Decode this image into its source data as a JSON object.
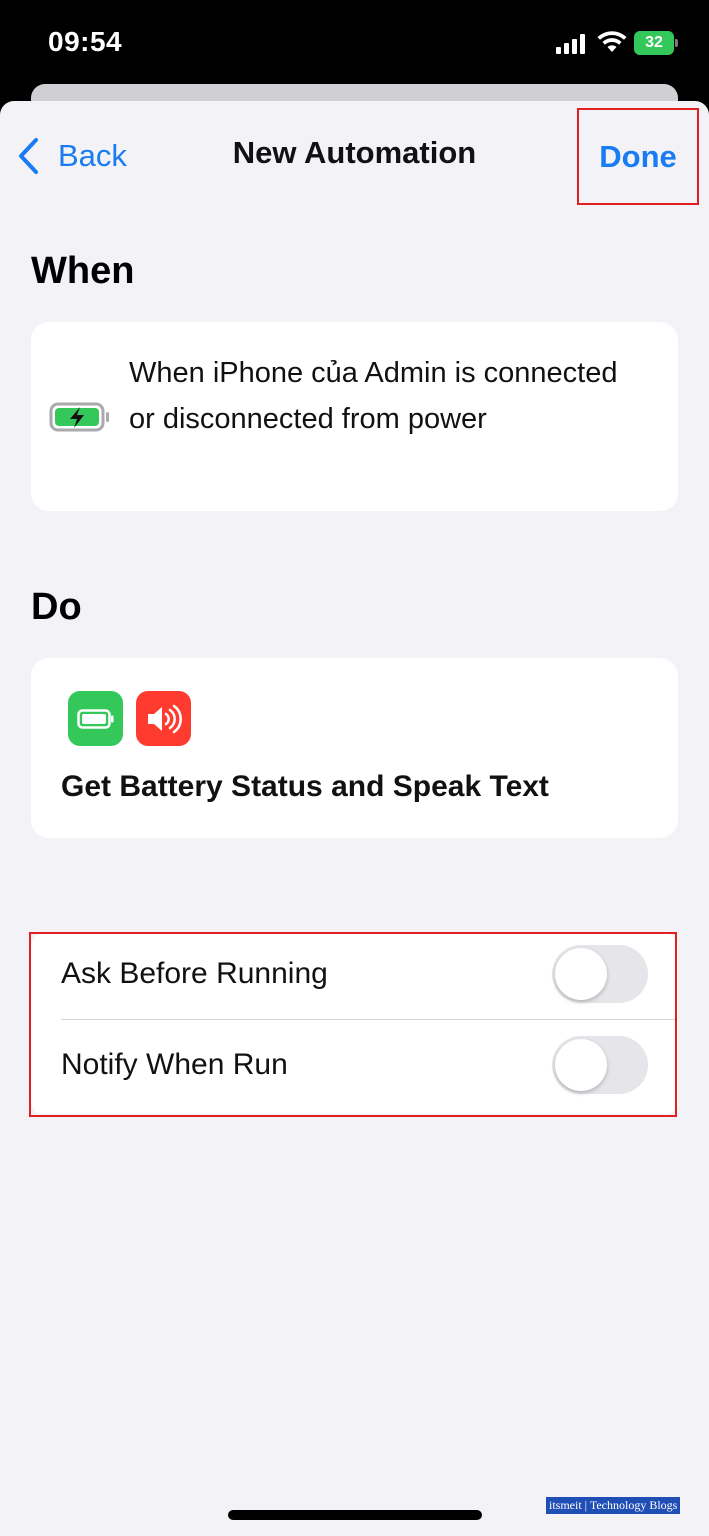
{
  "status_bar": {
    "time": "09:54",
    "battery_level": "32"
  },
  "nav": {
    "back_label": "Back",
    "title": "New Automation",
    "done_label": "Done"
  },
  "when": {
    "heading": "When",
    "trigger_text": "When iPhone của Admin is connected or disconnected from power",
    "icon": "battery-charging-icon"
  },
  "do": {
    "heading": "Do",
    "icons": [
      "battery-app-icon",
      "speaker-app-icon"
    ],
    "action_text": "Get Battery Status and Speak Text"
  },
  "options": [
    {
      "label": "Ask Before Running",
      "enabled": false
    },
    {
      "label": "Notify When Run",
      "enabled": false
    }
  ],
  "watermark": "itsmeit | Technology Blogs",
  "colors": {
    "accent": "#1a7cf2",
    "highlight": "#e02020",
    "green": "#34c759",
    "red": "#ff3b30"
  }
}
